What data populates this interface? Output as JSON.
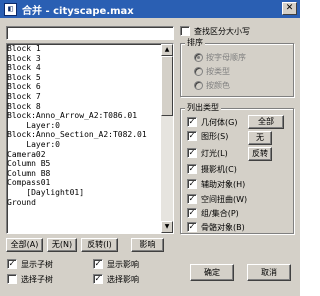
{
  "window": {
    "title": "合并 - cityscape.max",
    "icon_glyph": "◧",
    "close_glyph": "✕"
  },
  "search": {
    "value": ""
  },
  "list": {
    "items": [
      "Block 1",
      "Block 3",
      "Block 4",
      "Block 5",
      "Block 6",
      "Block 7",
      "Block 8",
      "Block:Anno_Arrow_A2:T086.01",
      "    Layer:0",
      "Block:Anno_Section_A2:T082.01",
      "    Layer:0",
      "Camera02",
      "Column B5",
      "Column B8",
      "Compass01",
      "    [Daylight01]",
      "Ground"
    ],
    "scroll_up": "▲",
    "scroll_down": "▼"
  },
  "bottom_buttons": {
    "all": "全部(A)",
    "none": "无(N)",
    "invert": "反转(I)",
    "influence": "影响"
  },
  "bottom_checks": {
    "show_subtree": "显示子树",
    "select_subtree": "选择子树",
    "show_influence": "显示影响",
    "select_influence": "选择影响"
  },
  "case_sensitive": "查找区分大小写",
  "sort": {
    "title": "排序",
    "alpha": "按字母顺序",
    "type": "按类型",
    "color": "按颜色"
  },
  "list_types": {
    "title": "列出类型",
    "items": [
      "几何体(G)",
      "图形(S)",
      "灯光(L)",
      "摄影机(C)",
      "辅助对象(H)",
      "空间扭曲(W)",
      "组/集合(P)",
      "骨骼对象(B)"
    ],
    "all": "全部",
    "none": "无",
    "invert": "反转"
  },
  "actions": {
    "ok": "确定",
    "cancel": "取消"
  },
  "check_glyph": "✓"
}
